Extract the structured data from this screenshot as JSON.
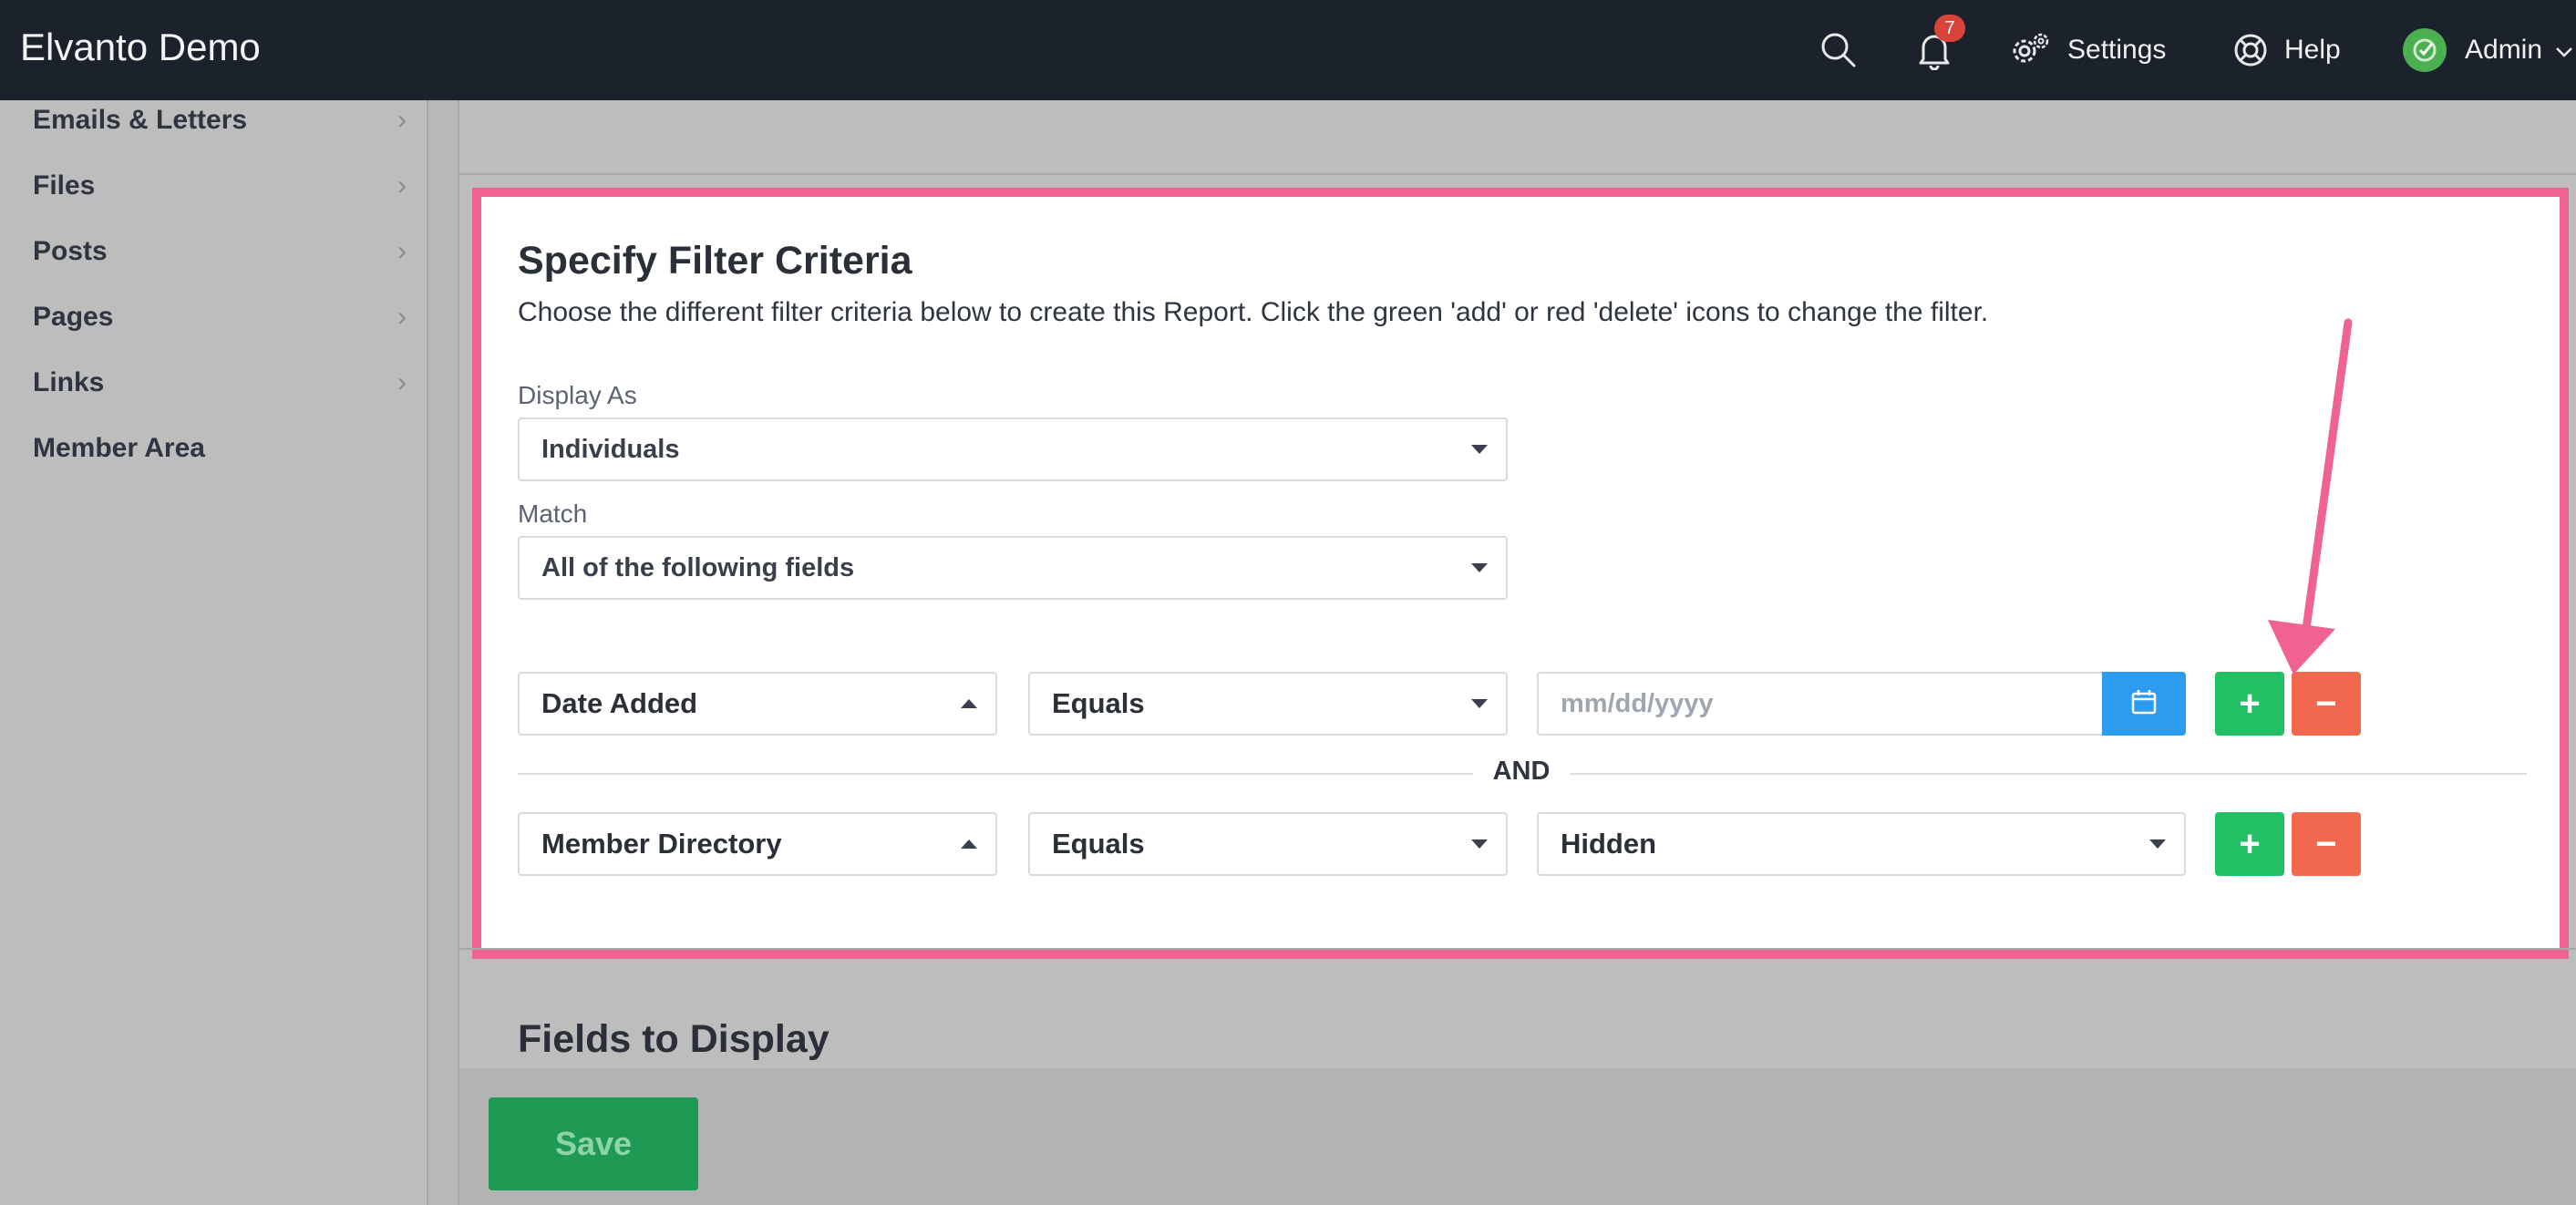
{
  "app": {
    "title": "Elvanto Demo"
  },
  "topbar": {
    "notifications_count": "7",
    "settings_label": "Settings",
    "help_label": "Help",
    "user_label": "Admin"
  },
  "sidebar": {
    "items": [
      {
        "label": "Emails & Letters",
        "has_chevron": true
      },
      {
        "label": "Files",
        "has_chevron": true
      },
      {
        "label": "Posts",
        "has_chevron": true
      },
      {
        "label": "Pages",
        "has_chevron": true
      },
      {
        "label": "Links",
        "has_chevron": true
      },
      {
        "label": "Member Area",
        "has_chevron": false
      }
    ]
  },
  "filter_card": {
    "title": "Specify Filter Criteria",
    "description": "Choose the different filter criteria below to create this Report. Click the green 'add' or red 'delete' icons to change the filter.",
    "display_as": {
      "label": "Display As",
      "value": "Individuals"
    },
    "match": {
      "label": "Match",
      "value": "All of the following fields"
    },
    "conjunction": "AND",
    "rows": [
      {
        "field": "Date Added",
        "operator": "Equals",
        "value_placeholder": "mm/dd/yyyy",
        "add": "+",
        "delete": "−"
      },
      {
        "field": "Member Directory",
        "operator": "Equals",
        "value": "Hidden",
        "add": "+",
        "delete": "−"
      }
    ]
  },
  "fields_section": {
    "title": "Fields to Display"
  },
  "footer": {
    "save_label": "Save"
  },
  "colors": {
    "topbar": "#1b222c",
    "highlight": "#f06292",
    "add_button": "#21c064",
    "delete_button": "#f2684f",
    "calendar_button": "#2d9cf0",
    "save_button": "#1f9a55"
  },
  "icons": [
    "search-icon",
    "bell-icon",
    "gear-icon",
    "lifebuoy-icon",
    "avatar-check-icon",
    "calendar-icon",
    "chevron-right-icon",
    "caret-down-icon",
    "caret-up-icon",
    "plus-icon",
    "minus-icon",
    "annotation-arrow"
  ]
}
